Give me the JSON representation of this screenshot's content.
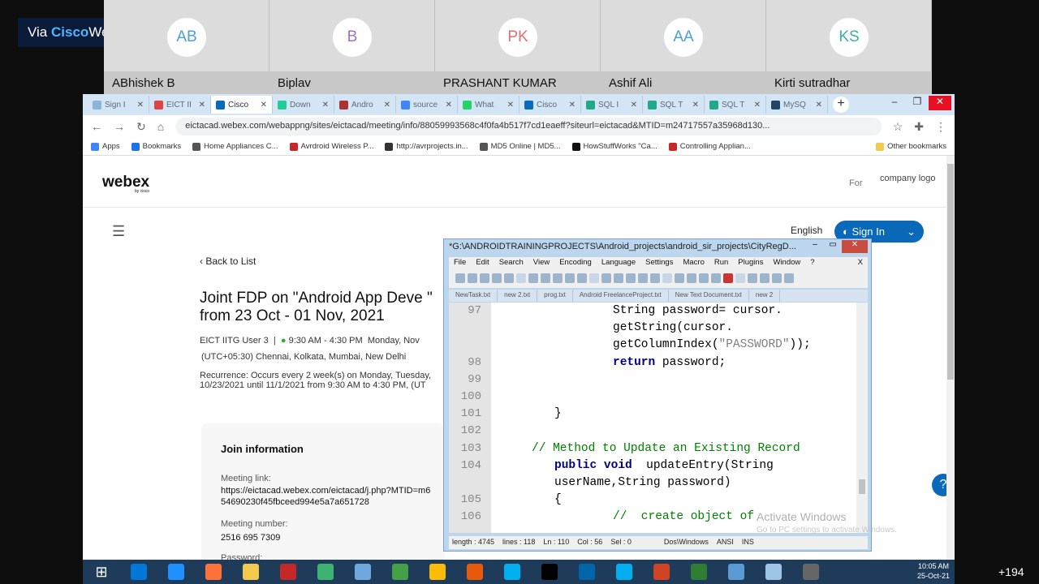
{
  "overlay": {
    "via_prefix": "Via ",
    "via_brand": "Cisco",
    "via_suffix": "Webex",
    "more_count": "+194"
  },
  "participants": [
    {
      "initials": "AB",
      "name": "ABhishek B",
      "color": "#4aa0d8"
    },
    {
      "initials": "B",
      "name": "Biplav",
      "color": "#a070c8"
    },
    {
      "initials": "PK",
      "name": "PRASHANT KUMAR",
      "color": "#e07070"
    },
    {
      "initials": "AA",
      "name": "Ashif Ali",
      "color": "#4aa0d8"
    },
    {
      "initials": "KS",
      "name": "Kirti sutradhar",
      "color": "#3ab0a0"
    }
  ],
  "browser": {
    "tabs": [
      {
        "label": "Sign I",
        "icon": "#8ab4d8"
      },
      {
        "label": "EICT II",
        "icon": "#d44"
      },
      {
        "label": "Cisco",
        "icon": "#0a69b8",
        "active": true
      },
      {
        "label": "Down",
        "icon": "#2c9"
      },
      {
        "label": "Andro",
        "icon": "#a33"
      },
      {
        "label": "source",
        "icon": "#4285f4"
      },
      {
        "label": "What",
        "icon": "#25d366"
      },
      {
        "label": "Cisco",
        "icon": "#0a69b8"
      },
      {
        "label": "SQL I",
        "icon": "#2a8"
      },
      {
        "label": "SQL T",
        "icon": "#2a8"
      },
      {
        "label": "SQL T",
        "icon": "#2a8"
      },
      {
        "label": "MySQ",
        "icon": "#246"
      }
    ],
    "url": "eictacad.webex.com/webappng/sites/eictacad/meeting/info/88059993568c4f0fa4b517f7cd1eaeff?siteurl=eictacad&MTID=m24717557a35968d130...",
    "bookmarks": [
      "Apps",
      "Bookmarks",
      "Home Appliances C...",
      "Avrdroid Wireless P...",
      "http://avrprojects.in...",
      "MD5 Online | MD5...",
      "HowStuffWorks \"Ca...",
      "Controlling Applian..."
    ],
    "other_bookmarks": "Other bookmarks"
  },
  "page": {
    "logo": "webex",
    "logo_sub": "by cisco",
    "for": "For",
    "company_logo": "company logo",
    "language": "English",
    "sign_in": "Sign In",
    "back": "Back to List",
    "title": "Joint FDP on \"Android App Deve \" from 23 Oct - 01 Nov, 2021",
    "host": "EICT IITG User 3",
    "time": "9:30 AM - 4:30 PM",
    "day": "Monday, Nov",
    "timezone": "(UTC+05:30) Chennai, Kolkata, Mumbai, New Delhi",
    "recurrence": "Recurrence: Occurs every 2 week(s) on Monday, Tuesday, 10/23/2021 until 11/1/2021 from 9:30 AM to 4:30 PM, (UT",
    "join_heading": "Join information",
    "link_label": "Meeting link:",
    "link_value": "https://eictacad.webex.com/eictacad/j.php?MTID=m654690230f45fbceed994e5a7a651728",
    "number_label": "Meeting number:",
    "number_value": "2516 695 7309",
    "password_label": "Password:"
  },
  "npp": {
    "title": "*G:\\ANDROIDTRAININGPROJECTS\\Android_projects\\android_sir_projects\\CityRegD...",
    "menu": [
      "File",
      "Edit",
      "Search",
      "View",
      "Encoding",
      "Language",
      "Settings",
      "Macro",
      "Run",
      "Plugins",
      "Window",
      "?"
    ],
    "tabs": [
      "NewTask.txt",
      "new 2.txt",
      "prog.txt",
      "Android FreelanceProject.txt",
      "New Text Document.txt",
      "new 2"
    ],
    "lines": [
      {
        "n": "97",
        "code": "String password= cursor.",
        "kind": "plain"
      },
      {
        "n": "",
        "code": "getString(cursor.",
        "kind": "plain"
      },
      {
        "n": "",
        "code": "getColumnIndex(\"PASSWORD\"));",
        "kind": "plain"
      },
      {
        "n": "98",
        "code": "return password;",
        "kind": "plain"
      },
      {
        "n": "99",
        "code": "",
        "kind": "plain"
      },
      {
        "n": "100",
        "code": "",
        "kind": "plain"
      },
      {
        "n": "101",
        "code": "}",
        "kind": "plain"
      },
      {
        "n": "102",
        "code": "",
        "kind": "plain"
      },
      {
        "n": "103",
        "code": "// Method to Update an Existing Record",
        "kind": "comment"
      },
      {
        "n": "104",
        "code": "public void  updateEntry(String",
        "kind": "plain"
      },
      {
        "n": "",
        "code": "userName,String password)",
        "kind": "plain"
      },
      {
        "n": "105",
        "code": "{",
        "kind": "plain"
      },
      {
        "n": "106",
        "code": "//  create object of",
        "kind": "comment"
      }
    ],
    "status": [
      "length : 4745",
      "lines : 118",
      "Ln : 110",
      "Col : 56",
      "Sel : 0",
      "Dos\\Windows",
      "ANSI",
      "INS"
    ]
  },
  "windows_notice": {
    "line1": "Activate Windows",
    "line2": "Go to PC settings to activate Windows."
  },
  "taskbar": {
    "time": "10:05 AM",
    "date": "25-Oct-21",
    "apps": [
      "#0078d7",
      "#1e90ff",
      "#ff7139",
      "#f2c94c",
      "#c62828",
      "#3cb371",
      "#6fa8dc",
      "#43a047",
      "#fbbc05",
      "#e8590c",
      "#00aff0",
      "#000",
      "#0065a9",
      "#00aff0",
      "#d04423",
      "#2e7d32",
      "#5b9bd5",
      "#9ec5e8",
      "#666"
    ]
  }
}
